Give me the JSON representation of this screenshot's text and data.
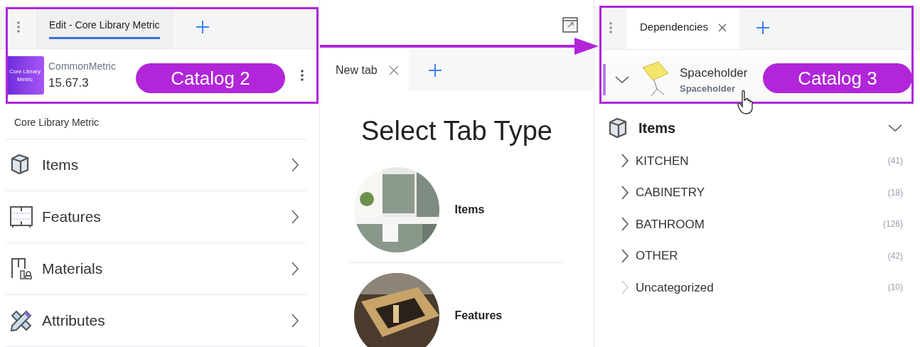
{
  "left_panel": {
    "tabs": [
      {
        "label": "Edit - Core Library Metric",
        "selected": true
      }
    ],
    "catalog": {
      "logo_text": "Core Library Metric",
      "name": "CommonMetric",
      "version": "15.67.3"
    },
    "section_label": "Core Library Metric",
    "menu": [
      {
        "label": "Items"
      },
      {
        "label": "Features"
      },
      {
        "label": "Materials"
      },
      {
        "label": "Attributes"
      }
    ]
  },
  "middle_panel": {
    "tabs": [
      {
        "label": "New tab",
        "selected": true
      }
    ],
    "heading": "Select Tab Type",
    "options": [
      {
        "label": "Items",
        "kind": "picture"
      },
      {
        "label": "Features",
        "kind": "picture"
      }
    ]
  },
  "right_panel": {
    "tabs": [
      {
        "label": "Dependencies",
        "selected": true
      }
    ],
    "dependency": {
      "title": "Spaceholder",
      "subtitle": "Spaceholder",
      "expanded": true
    },
    "section": {
      "title": "Items",
      "expanded": true
    },
    "tree": [
      {
        "label": "KITCHEN",
        "count": "(41)",
        "expandable": true
      },
      {
        "label": "CABINETRY",
        "count": "(18)",
        "expandable": true
      },
      {
        "label": "BATHROOM",
        "count": "(126)",
        "expandable": true
      },
      {
        "label": "OTHER",
        "count": "(42)",
        "expandable": true
      },
      {
        "label": "Uncategorized",
        "count": "(10)",
        "expandable": false
      }
    ]
  },
  "annotations": [
    {
      "label": "Catalog 2"
    },
    {
      "label": "Catalog 3"
    }
  ]
}
